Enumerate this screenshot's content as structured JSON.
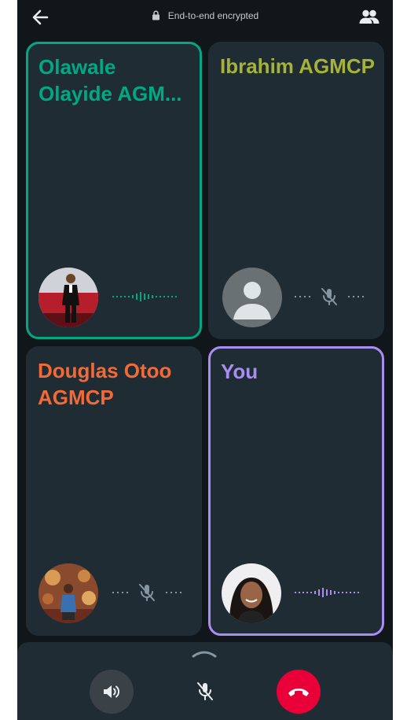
{
  "header": {
    "encryption_text": "End-to-end encrypted",
    "back_icon": "arrow-left-icon",
    "lock_icon": "lock-icon",
    "participants_icon": "people-icon"
  },
  "participants": [
    {
      "name": "Olawale Olayide AGM...",
      "color": "#00a884",
      "status": "speaking",
      "avatar": "photo"
    },
    {
      "name": "Ibrahim AGMCP",
      "color": "#a5b337",
      "status": "muted",
      "avatar": "default-person-icon"
    },
    {
      "name": "Douglas Otoo AGMCP",
      "color": "#f26a38",
      "status": "muted",
      "avatar": "photo"
    },
    {
      "name": "You",
      "color": "#a98ef1",
      "status": "speaking",
      "avatar": "photo"
    }
  ],
  "controls": {
    "speaker_icon": "speaker-icon",
    "mute_icon": "mic-off-icon",
    "end_call_icon": "end-call-icon",
    "expand_icon": "chevron-up-icon",
    "end_call_color": "#ea0038"
  }
}
